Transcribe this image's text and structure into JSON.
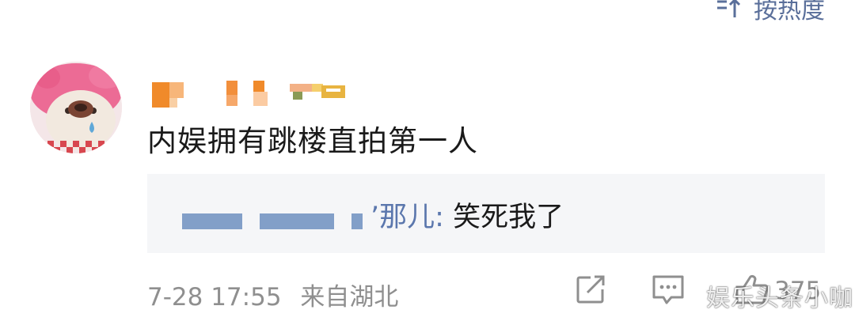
{
  "sort": {
    "icon": "sort-icon",
    "label": "按热度"
  },
  "comment": {
    "avatar": "avatar-image",
    "username_blurred": true,
    "text": "内娱拥有跳楼直拍第一人",
    "reply": {
      "author_visible": "’那儿",
      "separator": ":",
      "text": "笑死我了"
    },
    "meta": {
      "time": "7-28 17:55",
      "location": "来自湖北"
    },
    "actions": {
      "share_icon": "share-icon",
      "comment_icon": "comment-icon",
      "like_icon": "thumbs-up-icon",
      "like_count": "375"
    }
  },
  "watermark": "娱乐头条小咖",
  "colors": {
    "link": "#5b77ad",
    "text": "#1a1a1a",
    "meta": "#8f8f8f",
    "reply_bg": "#f5f6f8"
  }
}
